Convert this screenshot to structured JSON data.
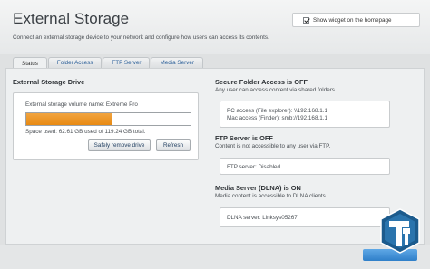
{
  "header": {
    "title": "External Storage",
    "subtitle": "Connect an external storage device to your network and configure how users can access its contents.",
    "widget_checkbox_label": "Show widget on the homepage",
    "widget_checked": true
  },
  "tabs": [
    {
      "label": "Status",
      "active": true
    },
    {
      "label": "Folder Access",
      "active": false
    },
    {
      "label": "FTP Server",
      "active": false
    },
    {
      "label": "Media Server",
      "active": false
    }
  ],
  "drive": {
    "heading": "External Storage Drive",
    "volume_label": "External storage volume name: Extreme Pro",
    "space_used_text": "Space used: 62.61 GB used of 119.24 GB total.",
    "used_fraction": 0.525,
    "bar_color": "#e88a13",
    "safely_remove_label": "Safely remove drive",
    "refresh_label": "Refresh"
  },
  "secure_folder": {
    "heading": "Secure Folder Access is OFF",
    "description": "Any user can access content via shared folders.",
    "pc_access": "PC access (File explorer): \\\\192.168.1.1",
    "mac_access": "Mac access (Finder): smb://192.168.1.1"
  },
  "ftp": {
    "heading": "FTP Server is OFF",
    "description": "Content is not accessible to any user via FTP.",
    "server_status": "FTP server: Disabled"
  },
  "media": {
    "heading": "Media Server (DLNA) is ON",
    "description": "Media content is accessible to DLNA clients",
    "server_name": "DLNA server: Linksys05267"
  }
}
